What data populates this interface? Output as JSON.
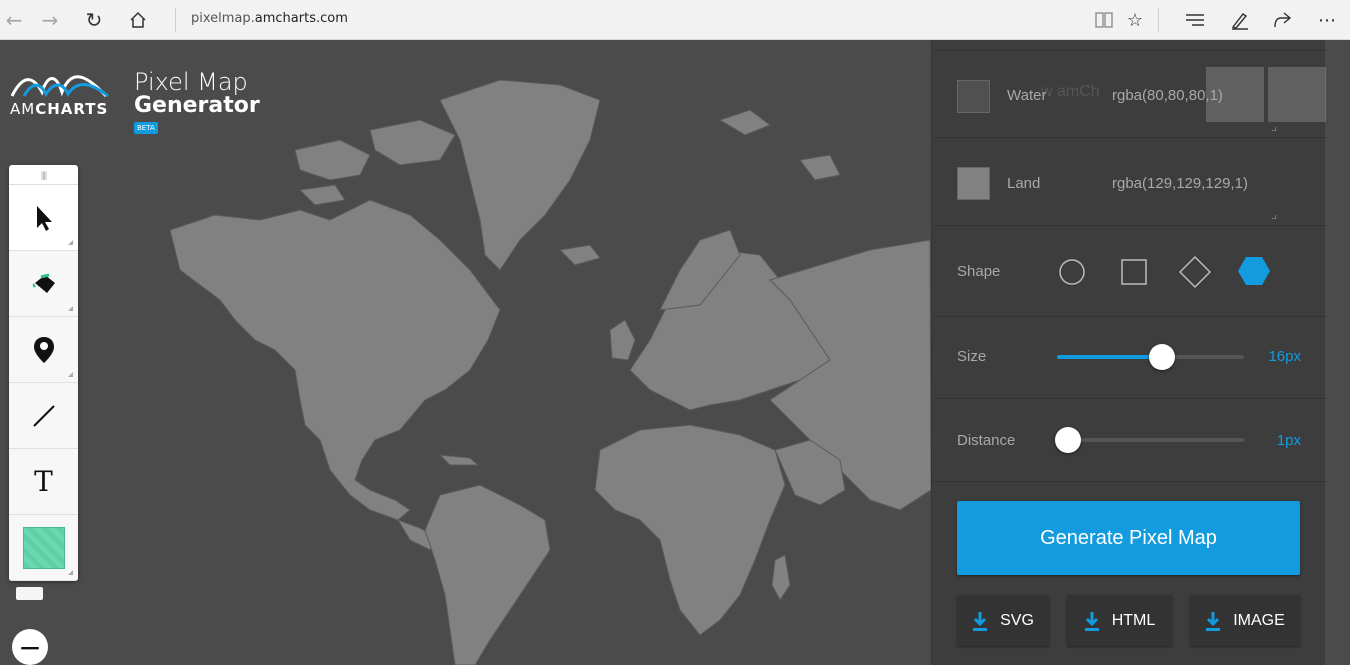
{
  "browser": {
    "url_prefix": "pixelmap.",
    "url_host": "amcharts.com",
    "icons": [
      "back-arrow-icon",
      "forward-arrow-icon",
      "refresh-icon",
      "home-icon",
      "reading-view-icon",
      "favorite-star-icon",
      "hub-icon",
      "notes-pen-icon",
      "share-icon",
      "more-icon"
    ]
  },
  "logo": {
    "text_am": "AM",
    "text_charts": "CHARTS"
  },
  "title": {
    "line1": "Pixel Map",
    "line2": "Generator",
    "badge": "BETA"
  },
  "toolbar": {
    "tools": [
      "pointer-tool",
      "paint-bucket-tool",
      "marker-tool",
      "line-tool",
      "text-tool",
      "color-swatch-tool"
    ],
    "text_tool_glyph": "T"
  },
  "zoom": {
    "out": "−"
  },
  "panel": {
    "ghost_text": "w amCh",
    "water": {
      "label": "Water",
      "value": "rgba(80,80,80,1)",
      "color": "#505050"
    },
    "land": {
      "label": "Land",
      "value": "rgba(129,129,129,1)",
      "color": "#818181"
    },
    "shape": {
      "label": "Shape",
      "options": [
        "circle",
        "square",
        "diamond",
        "hexagon"
      ],
      "selected": "hexagon"
    },
    "size": {
      "label": "Size",
      "value": "16px",
      "fraction": 0.55
    },
    "distance": {
      "label": "Distance",
      "value": "1px",
      "fraction": 0.05
    },
    "generate_label": "Generate Pixel Map",
    "downloads": [
      "SVG",
      "HTML",
      "IMAGE"
    ]
  },
  "colors": {
    "accent": "#139be0",
    "background": "#4b4b4b",
    "land": "#818181",
    "panel": "#3d3d3d"
  }
}
